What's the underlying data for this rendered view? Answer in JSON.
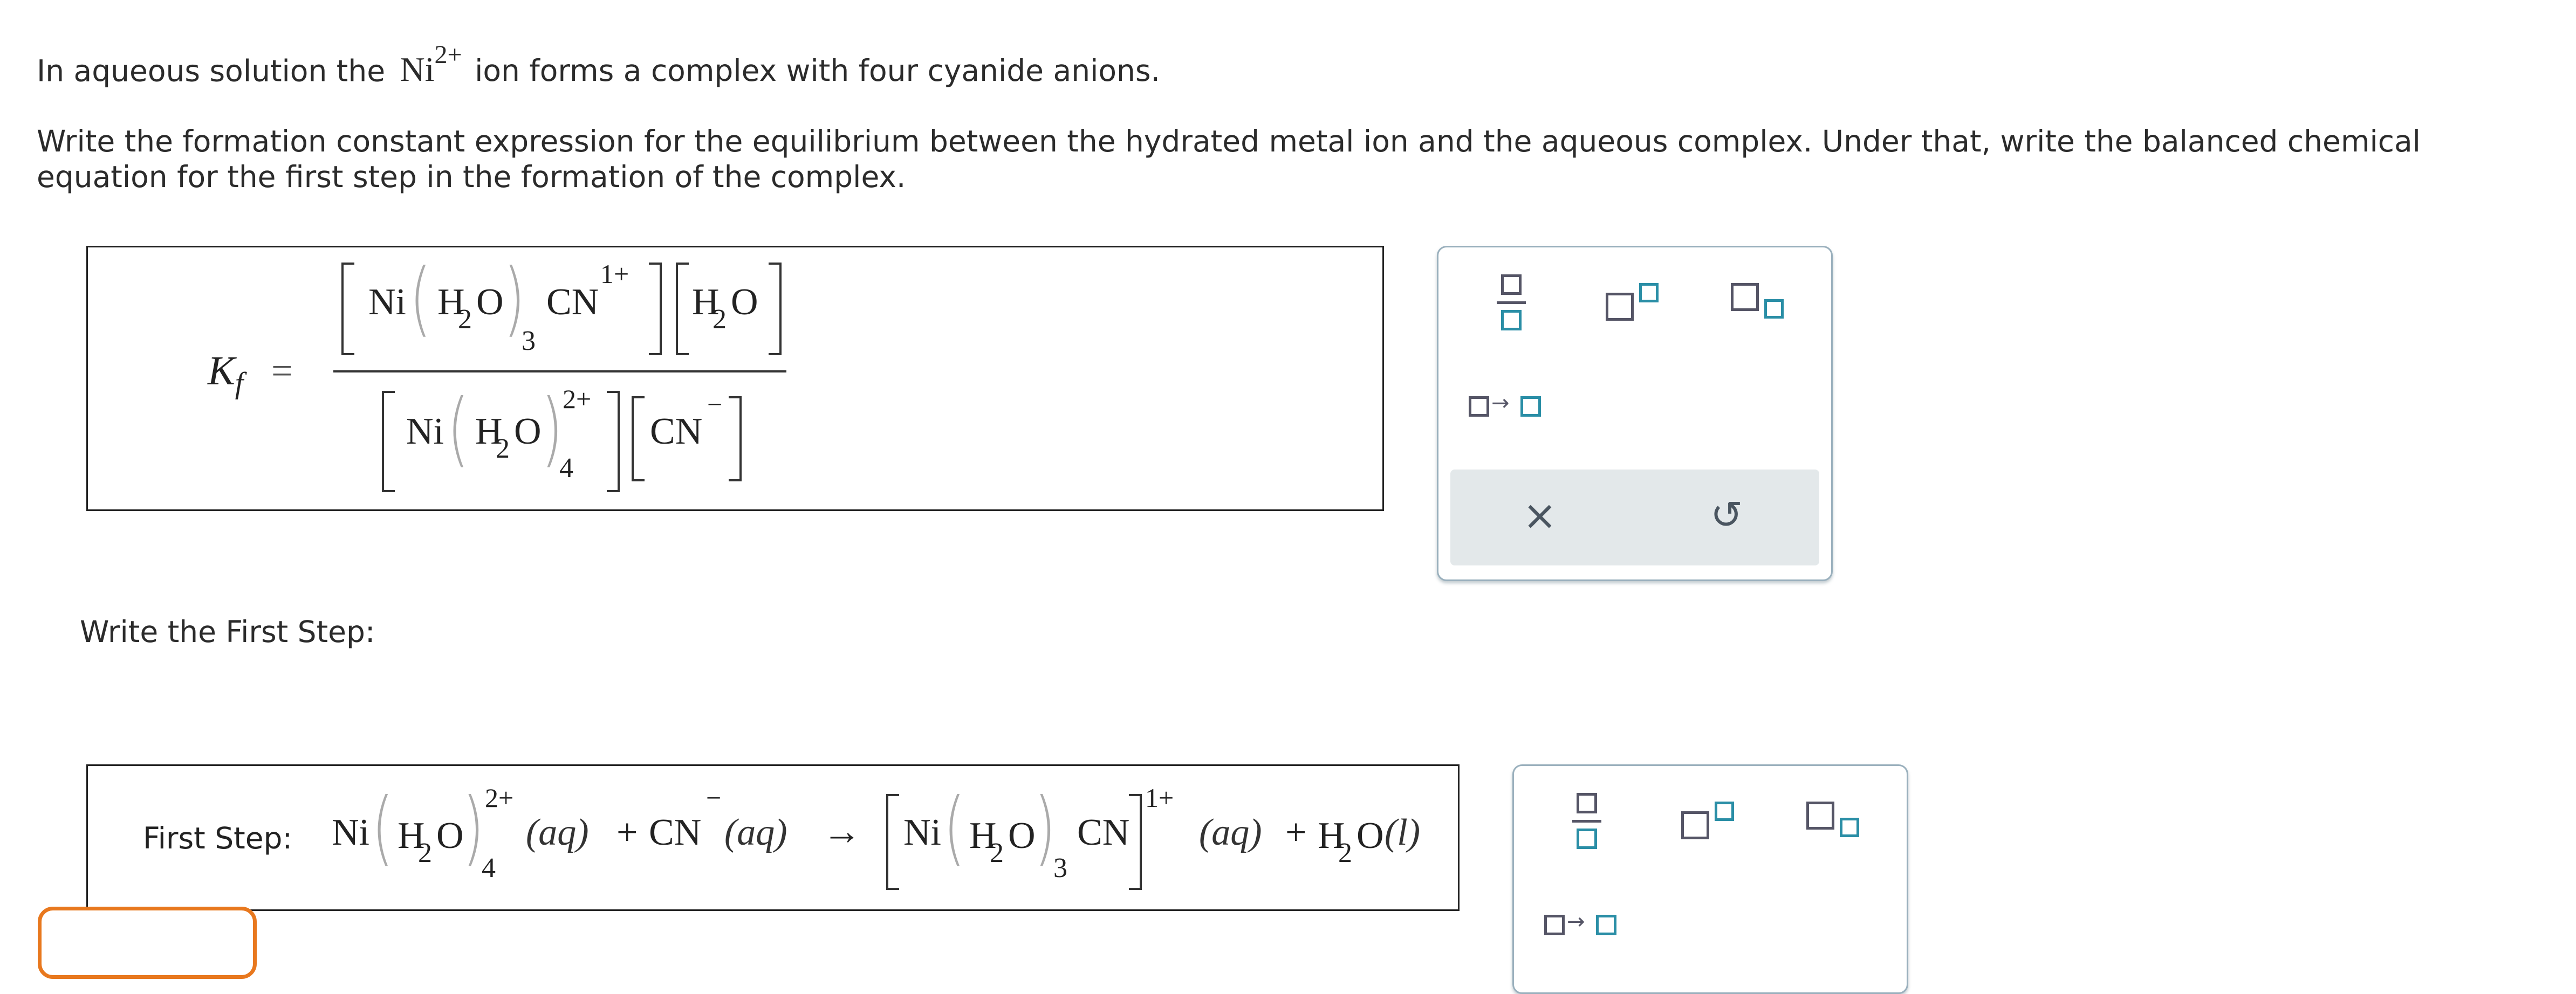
{
  "question": {
    "line1_before": "In aqueous solution the",
    "ion_symbol": "Ni",
    "ion_charge": "2+",
    "line1_after": "ion forms a complex with four cyanide anions.",
    "instructions_line1": "Write the formation constant expression for the equilibrium between the hydrated metal ion and the aqueous complex. Under that, write the balanced chemical",
    "instructions_line2": "equation for the first step in the formation of the complex."
  },
  "kf": {
    "symbol": "K",
    "subscript": "f",
    "equals": "=",
    "numerator": {
      "complex_ni": "Ni",
      "h2o_h": "H",
      "h2o_sub": "2",
      "h2o_o": "O",
      "count": "3",
      "cn": "CN",
      "charge": "1+",
      "water_h": "H",
      "water_sub": "2",
      "water_o": "O"
    },
    "denominator": {
      "ni": "Ni",
      "h2o_h": "H",
      "h2o_sub": "2",
      "h2o_o": "O",
      "count": "4",
      "charge": "2+",
      "cn": "CN",
      "cn_charge": "−"
    }
  },
  "first_step": {
    "heading": "Write the First Step:",
    "label": "First Step:",
    "ni": "Ni",
    "h": "H",
    "sub2": "2",
    "o": "O",
    "count4": "4",
    "charge_reactant": "2+",
    "aq": "(aq)",
    "plus": "+",
    "cn": "CN",
    "cn_charge": "−",
    "arrow": "→",
    "count3": "3",
    "charge_product": "1+",
    "water_state": "(l)"
  },
  "toolbar": {
    "fraction_icon": "fraction-template",
    "superscript_icon": "superscript-template",
    "subscript_icon": "subscript-template",
    "arrow_icon": "reaction-arrow-template",
    "clear_label": "×",
    "undo_label": "↺",
    "accent": "#2a8ea6",
    "border": "#9ab0bd"
  },
  "colors": {
    "focus_outline": "#e8781e"
  }
}
